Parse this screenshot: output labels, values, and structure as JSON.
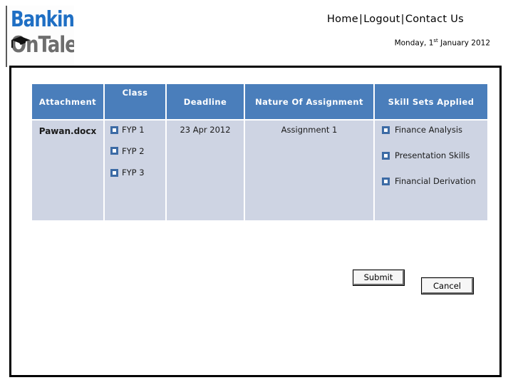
{
  "brand": {
    "logo_line1": "Banking",
    "logo_line2": "OnTalent",
    "logo_icon": "graduation-cap-icon"
  },
  "header": {
    "nav_items": [
      {
        "label": "Home"
      },
      {
        "label": "Logout"
      },
      {
        "label": "Contact Us"
      }
    ],
    "separator": "|",
    "date_prefix": "Monday, 1",
    "date_ordinal": "st",
    "date_suffix": " January 2012"
  },
  "table": {
    "columns": [
      {
        "label": "Attachment"
      },
      {
        "label": "Class"
      },
      {
        "label": "Deadline"
      },
      {
        "label": "Nature Of Assignment"
      },
      {
        "label": "Skill Sets Applied"
      }
    ],
    "row": {
      "attachment": "Pawan.docx",
      "classes": [
        {
          "label": "FYP 1",
          "checked": false
        },
        {
          "label": "FYP 2",
          "checked": false
        },
        {
          "label": "FYP 3",
          "checked": false
        }
      ],
      "deadline": "23 Apr 2012",
      "nature": "Assignment 1",
      "skills": [
        {
          "label": "Finance Analysis",
          "checked": false
        },
        {
          "label": "Presentation Skills",
          "checked": false
        },
        {
          "label": "Financial Derivation",
          "checked": false
        }
      ]
    }
  },
  "actions": {
    "submit_label": "Submit",
    "cancel_label": "Cancel"
  },
  "colors": {
    "header_blue": "#4a7ebb",
    "cell_blue": "#ced4e3",
    "checkbox_blue": "#3c6ba5",
    "logo_blue": "#1f6fc4",
    "logo_gray": "#6d6d6d"
  }
}
